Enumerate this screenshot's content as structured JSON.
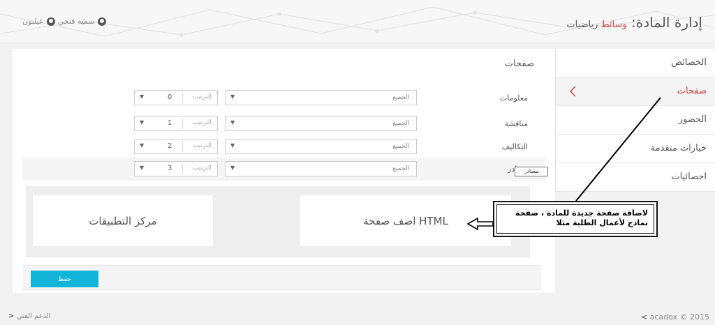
{
  "header": {
    "title": "إدارة المادة:",
    "course_link": "وسائط",
    "course_name": "رياضيات",
    "user1": "سمية فتحي",
    "user2": "عيلبون"
  },
  "sidebar": {
    "items": [
      {
        "label": "الخصائص"
      },
      {
        "label": "صفحات"
      },
      {
        "label": "الحضور"
      },
      {
        "label": "خيارات متقدمة"
      },
      {
        "label": "احصائيات"
      }
    ]
  },
  "main": {
    "section_title": "صفحات",
    "rows": [
      {
        "label": "معلومات",
        "visibility": "الجميع",
        "order_label": "الترتيب",
        "order": "0"
      },
      {
        "label": "مناقشة",
        "visibility": "الجميع",
        "order_label": "الترتيب",
        "order": "1"
      },
      {
        "label": "التكاليف",
        "visibility": "الجميع",
        "order_label": "الترتيب",
        "order": "2"
      },
      {
        "label": "مصادر",
        "visibility": "الجميع",
        "order_label": "الترتيب",
        "order": "3"
      }
    ],
    "tooltip": "مصادر",
    "cards": {
      "apps": "مركز التطبيقات",
      "add_html": "اضف صفحة HTML"
    },
    "save_label": "حفظ"
  },
  "annotation": {
    "line1": "لاضافة صفحة جديدة للمادة ، صفحة",
    "line2": "نماذج لأعمال الطلبة مثلا"
  },
  "footer": {
    "support": "الدعم الفني",
    "copyright": "acadox © 2015"
  },
  "colors": {
    "accent_red": "#d43f3a",
    "save_button": "#12b5d8"
  }
}
